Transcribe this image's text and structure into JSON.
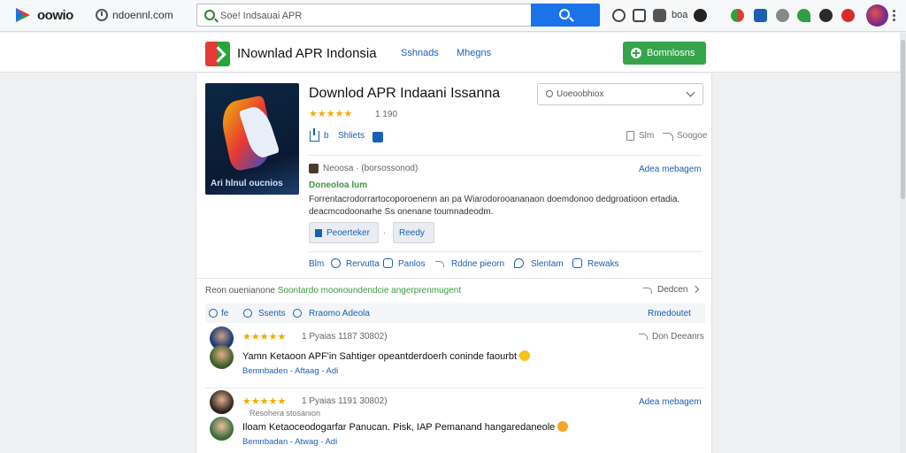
{
  "browser": {
    "brand": "oowio",
    "url": "ndoennl.com",
    "search_value": "Soe! Indsauai APR",
    "label_bo": "boa"
  },
  "site": {
    "title": "INownlad APR Indonsia",
    "nav": [
      "Sshnads",
      "Mhegns"
    ],
    "cta": "Bomnlosns"
  },
  "app": {
    "title": "Downlod APR Indaani Issanna",
    "rating_count": "1 190",
    "icon_caption": "Ari hlnul oucnios",
    "share_label": "Shliets",
    "dropdown_label": "Uoeoobhiox",
    "copy_label": "Slm",
    "share_right": "Soogoe",
    "developer_line": "Neoosa · (borsossonod)",
    "about_link": "Adea mebagem",
    "developer_name": "Doneoloa lum",
    "description": "Forrentacrodorrartocoporoenenn an pa Wiarodorooananaon doemdonoo dedgroatioon ertadia. deacmcodoonarhe Ss onenane toumnadeodm.",
    "btn_primary": "Peoerteker",
    "btn_secondary": "Reedy",
    "tools": [
      "Blm",
      "Rervutta",
      "Panlos",
      "Rddne pieorn",
      "Slentam",
      "Rewaks"
    ]
  },
  "reviews_section": {
    "related_prefix": "Reon ouenianone ",
    "related_green": "Soontardo moonoundendcie angerprenmugent",
    "related_action": "Dedcen",
    "filters": [
      "fe",
      "Ssents",
      "Rraomo Adeola"
    ],
    "filter_right": "Rmedoutet",
    "reviews": [
      {
        "rating_text": "1 Pyaias 1187 30802)",
        "side_action": "Don Deeanrs",
        "text": "Yamn Ketaoon APF'in Sahtiger opeantderdoerh coninde faourbt",
        "footer": "Bemnbaden - Aftaag - Adi"
      },
      {
        "rating_text": "1 Pyaias 1191 30802)",
        "side_action": "Adea mebagem",
        "sub_meta": "Resohera stosanion",
        "text": "Iloam Ketaoceodogarfar Panucan. Pisk, IAP Pemanand hangaredaneole",
        "footer": "Bemnbadan - Atwag - Adi"
      }
    ]
  },
  "colors": {
    "primary_blue": "#1a73e8",
    "cta_green": "#36a44b",
    "star": "#f2a900",
    "link": "#1a5fb4"
  },
  "icons": [
    "logo-icon",
    "clock-icon",
    "search-icon",
    "download-icon",
    "plus-icon",
    "share-icon",
    "copy-icon",
    "chevron-down-icon",
    "star-icon"
  ]
}
